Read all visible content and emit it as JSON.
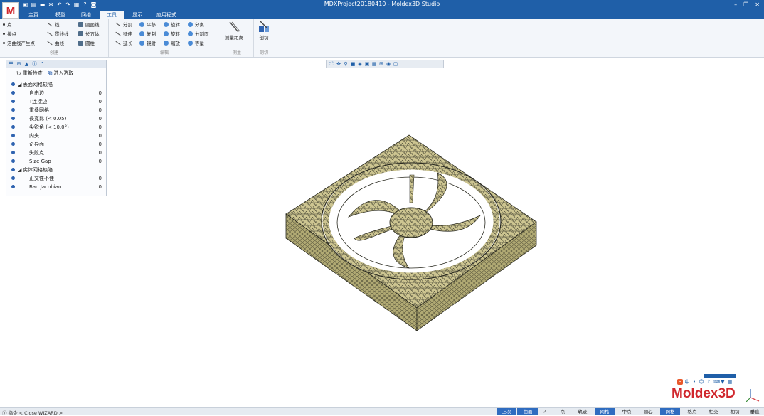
{
  "app": {
    "title": "MDXProject20180410 - Moldex3D Studio",
    "logo_letter": "M",
    "brand": "Moldex3D"
  },
  "window_controls": {
    "minimize": "–",
    "restore": "❐",
    "close": "✕"
  },
  "tabs": [
    {
      "label": "主頁",
      "active": false
    },
    {
      "label": "模型",
      "active": false
    },
    {
      "label": "网络",
      "active": false
    },
    {
      "label": "工具",
      "active": true
    },
    {
      "label": "显示",
      "active": false
    },
    {
      "label": "应用程式",
      "active": false
    }
  ],
  "ribbon": {
    "create": {
      "caption": "创建",
      "items": [
        "点",
        "线",
        "圆面线",
        "接点",
        "贯线线",
        "长方体",
        "沿曲线产生点",
        "曲线",
        "圆柱"
      ]
    },
    "edit": {
      "caption": "编辑",
      "items": [
        "分割",
        "平移",
        "旋转",
        "分离",
        "延伸",
        "复制",
        "旋转",
        "分割面",
        "延长",
        "镜射",
        "缩放",
        "等量"
      ]
    },
    "measure": {
      "caption": "测量",
      "button": "测量距离"
    },
    "cut": {
      "caption": "剖切",
      "button": "剖切"
    }
  },
  "panel": {
    "recheck_label": "重新检查",
    "pick_label": "进入选取",
    "rows": [
      {
        "label": "表面网格缺陷",
        "count": "",
        "group": true
      },
      {
        "label": "自由边",
        "count": "0",
        "group": false
      },
      {
        "label": "T连接边",
        "count": "0",
        "group": false
      },
      {
        "label": "重叠网格",
        "count": "0",
        "group": false
      },
      {
        "label": "長寬比 (< 0.05)",
        "count": "0",
        "group": false
      },
      {
        "label": "尖锐角 (< 10.0°)",
        "count": "0",
        "group": false
      },
      {
        "label": "内夹",
        "count": "0",
        "group": false
      },
      {
        "label": "奇异面",
        "count": "0",
        "group": false
      },
      {
        "label": "失败点",
        "count": "0",
        "group": false
      },
      {
        "label": "Size Gap",
        "count": "0",
        "group": false
      },
      {
        "label": "实体网格缺陷",
        "count": "",
        "group": true
      },
      {
        "label": "正交性不佳",
        "count": "0",
        "group": false
      },
      {
        "label": "Bad Jacobian",
        "count": "0",
        "group": false
      }
    ]
  },
  "status": {
    "message": "指令 < Close WIZARD >",
    "buttons": [
      {
        "label": "上次",
        "on": true
      },
      {
        "label": "曲面",
        "on": true
      },
      {
        "label": "点",
        "on": false
      },
      {
        "label": "轨迹",
        "on": false
      },
      {
        "label": "网格",
        "on": true
      },
      {
        "label": "中点",
        "on": false
      },
      {
        "label": "圆心",
        "on": false
      },
      {
        "label": "网格",
        "on": true
      },
      {
        "label": "格点",
        "on": false
      },
      {
        "label": "相交",
        "on": false
      },
      {
        "label": "相切",
        "on": false
      },
      {
        "label": "垂直",
        "on": false
      }
    ]
  },
  "ime": {
    "badge": "S",
    "lang": "中"
  },
  "colors": {
    "accent": "#1f5fa8",
    "brand_red": "#d0262c",
    "mesh_fill": "#c8c08a"
  }
}
